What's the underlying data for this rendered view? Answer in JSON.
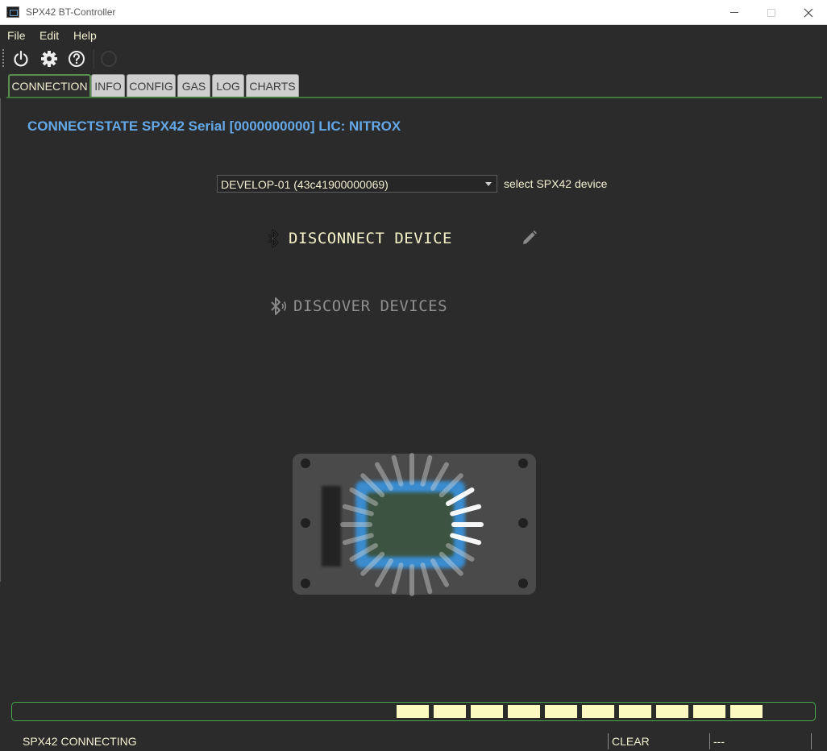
{
  "window": {
    "title": "SPX42 BT-Controller"
  },
  "menu": {
    "items": [
      {
        "label": "File"
      },
      {
        "label": "Edit"
      },
      {
        "label": "Help"
      }
    ]
  },
  "toolbar": {
    "icons": [
      "power-icon",
      "gear-icon",
      "help-icon",
      "status-circle-icon"
    ]
  },
  "tabs": [
    {
      "label": "CONNECTION",
      "active": true
    },
    {
      "label": "INFO"
    },
    {
      "label": "CONFIG"
    },
    {
      "label": "GAS"
    },
    {
      "label": "LOG"
    },
    {
      "label": "CHARTS"
    }
  ],
  "connection": {
    "header": "CONNECTSTATE SPX42 Serial [0000000000] LIC: NITROX",
    "device_select": {
      "value": "DEVELOP-01 (43c41900000069)",
      "label": "select SPX42 device"
    },
    "disconnect_label": "DISCONNECT DEVICE",
    "discover_label": "DISCOVER DEVICES"
  },
  "progress": {
    "chunks_filled": 10
  },
  "status": {
    "message": "SPX42 CONNECTING",
    "clear_label": "CLEAR",
    "info": "---"
  },
  "colors": {
    "accent_text": "#f2efd0",
    "header_blue": "#64a8e8",
    "progress_border": "#4aa94a",
    "progress_chunk": "#fbf9bf",
    "tab_border": "#5a8f4f",
    "background": "#2b2b2b"
  }
}
